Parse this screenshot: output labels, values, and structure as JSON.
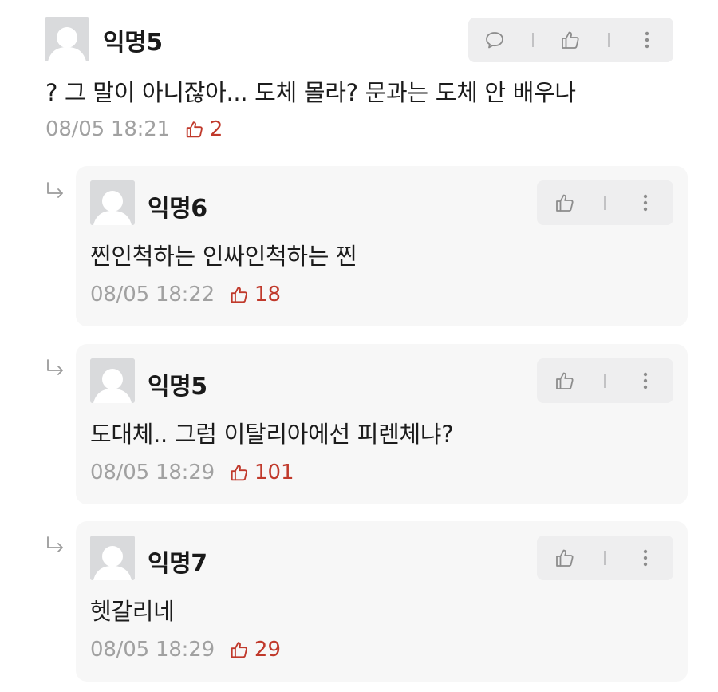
{
  "comments": [
    {
      "author": "익명5",
      "text": "? 그 말이 아니잖아... 도체 몰라? 문과는 도체 안 배우나",
      "timestamp": "08/05 18:21",
      "likes": "2",
      "is_reply": false,
      "actions": [
        "reply-icon",
        "thumbs-up-icon",
        "more-vertical-icon"
      ]
    },
    {
      "author": "익명6",
      "text": "찐인척하는 인싸인척하는 찐",
      "timestamp": "08/05 18:22",
      "likes": "18",
      "is_reply": true,
      "actions": [
        "thumbs-up-icon",
        "more-vertical-icon"
      ]
    },
    {
      "author": "익명5",
      "text": "도대체.. 그럼 이탈리아에선 피렌체냐?",
      "timestamp": "08/05 18:29",
      "likes": "101",
      "is_reply": true,
      "actions": [
        "thumbs-up-icon",
        "more-vertical-icon"
      ]
    },
    {
      "author": "익명7",
      "text": "헷갈리네",
      "timestamp": "08/05 18:29",
      "likes": "29",
      "is_reply": true,
      "actions": [
        "thumbs-up-icon",
        "more-vertical-icon"
      ]
    }
  ],
  "colors": {
    "like_accent": "#c0392b",
    "reply_background": "#f7f7f7",
    "action_bar_background": "#eeeeef",
    "avatar_placeholder": "#d9dadc",
    "meta_text": "#a1a1a1"
  }
}
